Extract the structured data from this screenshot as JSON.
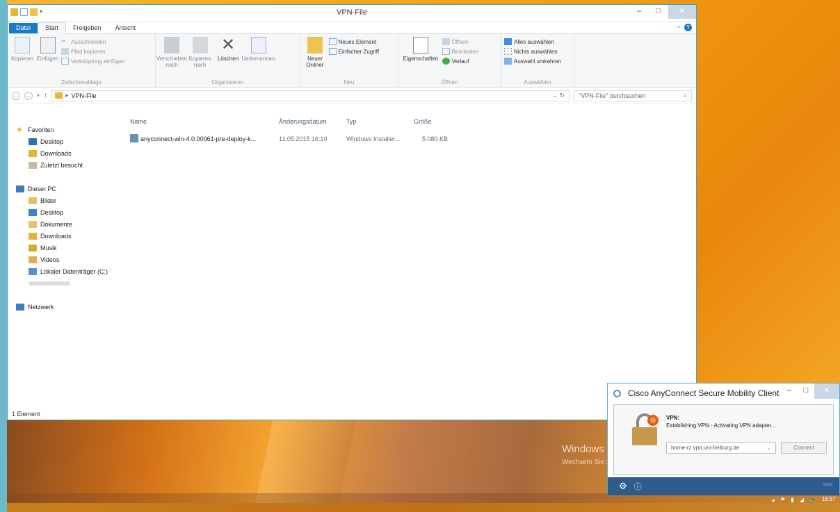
{
  "explorer": {
    "title": "VPN-File",
    "tabs": [
      {
        "label": "Datei"
      },
      {
        "label": "Start"
      },
      {
        "label": "Freigeben"
      },
      {
        "label": "Ansicht"
      }
    ],
    "ribbon": {
      "clipboard": {
        "name": "Zwischenablage",
        "copy": "Kopieren",
        "paste": "Einfügen",
        "cut": "Ausschneiden",
        "copy_path": "Pfad kopieren",
        "paste_link": "Verknüpfung einfügen"
      },
      "organize": {
        "name": "Organisieren",
        "move_to": "Verschieben nach",
        "copy_to": "Kopieren nach",
        "delete": "Löschen",
        "rename": "Umbenennen"
      },
      "new": {
        "name": "Neu",
        "new_folder": "Neuer Ordner",
        "new_item": "Neues Element",
        "easy_access": "Einfacher Zugriff"
      },
      "open": {
        "name": "Öffnen",
        "properties": "Eigenschaften",
        "open": "Öffnen",
        "edit": "Bearbeiten",
        "history": "Verlauf"
      },
      "select": {
        "name": "Auswählen",
        "select_all": "Alles auswählen",
        "select_none": "Nichts auswählen",
        "invert": "Auswahl umkehren"
      }
    },
    "address": {
      "path": "VPN-File",
      "search_placeholder": "\"VPN-File\" durchsuchen"
    },
    "nav": {
      "favorites": "Favoriten",
      "favorite_items": [
        "Desktop",
        "Downloads",
        "Zuletzt besucht"
      ],
      "this_pc": "Dieser PC",
      "pc_items": [
        "Bilder",
        "Desktop",
        "Dokumente",
        "Downloads",
        "Musik",
        "Videos",
        "Lokaler Datenträger (C:)"
      ],
      "network": "Netzwerk"
    },
    "columns": {
      "name": "Name",
      "date": "Änderungsdatum",
      "type": "Typ",
      "size": "Größe"
    },
    "files": [
      {
        "name": "anyconnect-win-4.0.00061-pre-deploy-k...",
        "date": "11.05.2015 16:10",
        "type": "Windows Installer...",
        "size": "5.080 KB"
      }
    ],
    "status": "1 Element"
  },
  "cisco": {
    "title": "Cisco AnyConnect Secure Mobility Client",
    "vpn_label": "VPN:",
    "status": "Establishing VPN - Activating VPN adapter...",
    "server": "home-rz.vpn.uni-freiburg.de",
    "connect": "Connect",
    "brand": "cisco"
  },
  "watermark": {
    "line1": "Windows aktivieren",
    "line2": "Wechseln Sie zu den PC-Einstellungen, um Windows zu aktivieren."
  },
  "taskbar": {
    "time": "18:57"
  },
  "colors": {
    "accent": "#1979ca",
    "cisco_footer": "#2e5c8c",
    "desktop": "#f6a81c"
  }
}
